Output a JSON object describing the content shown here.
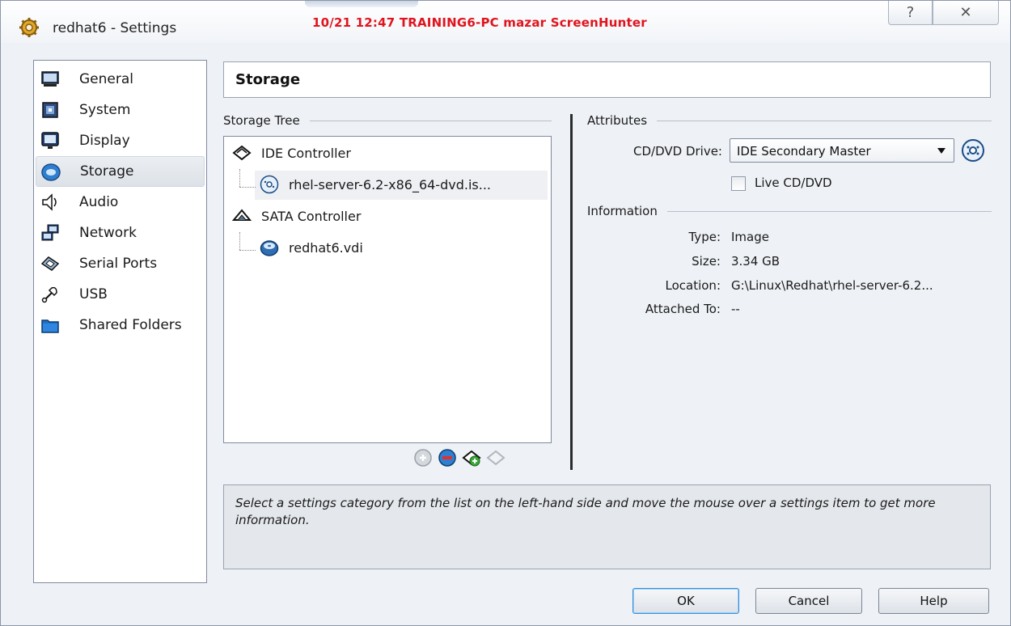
{
  "window": {
    "title": "redhat6 - Settings",
    "overlay_text": "10/21  12:47  TRAINING6-PC  mazar  ScreenHunter",
    "help_glyph": "?",
    "close_glyph": "✕"
  },
  "sidebar": {
    "items": [
      {
        "label": "General",
        "icon": "monitor-icon"
      },
      {
        "label": "System",
        "icon": "chip-icon"
      },
      {
        "label": "Display",
        "icon": "display-icon"
      },
      {
        "label": "Storage",
        "icon": "disc-icon",
        "selected": true
      },
      {
        "label": "Audio",
        "icon": "speaker-icon"
      },
      {
        "label": "Network",
        "icon": "network-icon"
      },
      {
        "label": "Serial Ports",
        "icon": "serial-port-icon"
      },
      {
        "label": "USB",
        "icon": "usb-icon"
      },
      {
        "label": "Shared Folders",
        "icon": "folder-icon"
      }
    ]
  },
  "header": {
    "title": "Storage"
  },
  "storage_tree": {
    "label": "Storage Tree",
    "nodes": [
      {
        "label": "IDE Controller",
        "type": "controller"
      },
      {
        "label": "rhel-server-6.2-x86_64-dvd.is...",
        "type": "optical",
        "selected": true
      },
      {
        "label": "SATA Controller",
        "type": "controller"
      },
      {
        "label": "redhat6.vdi",
        "type": "disk"
      }
    ]
  },
  "attributes": {
    "label": "Attributes",
    "cd_dvd_drive_label": "CD/DVD Drive:",
    "cd_dvd_drive_value": "IDE Secondary Master",
    "live_cd_label": "Live CD/DVD",
    "live_cd_checked": false
  },
  "information": {
    "label": "Information",
    "type_label": "Type:",
    "type_value": "Image",
    "size_label": "Size:",
    "size_value": "3.34 GB",
    "location_label": "Location:",
    "location_value": "G:\\Linux\\Redhat\\rhel-server-6.2...",
    "attached_label": "Attached To:",
    "attached_value": "--"
  },
  "description": "Select a settings category from the list on the left-hand side and move the mouse over a settings item to get more information.",
  "buttons": {
    "ok": "OK",
    "cancel": "Cancel",
    "help": "Help"
  }
}
